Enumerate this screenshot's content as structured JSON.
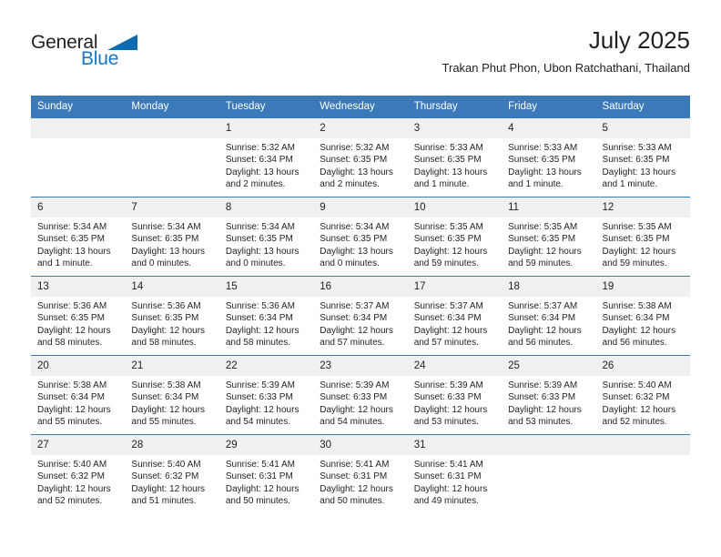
{
  "brand": {
    "name_part1": "General",
    "name_part2": "Blue"
  },
  "header": {
    "month_title": "July 2025",
    "location": "Trakan Phut Phon, Ubon Ratchathani, Thailand"
  },
  "colors": {
    "header_blue": "#3b79b8",
    "logo_blue": "#1b76bc",
    "daynum_bg": "#f0f0f0",
    "text": "#231f20"
  },
  "weekday_headers": [
    "Sunday",
    "Monday",
    "Tuesday",
    "Wednesday",
    "Thursday",
    "Friday",
    "Saturday"
  ],
  "weeks": [
    [
      {
        "day": "",
        "lines": []
      },
      {
        "day": "",
        "lines": []
      },
      {
        "day": "1",
        "lines": [
          "Sunrise: 5:32 AM",
          "Sunset: 6:34 PM",
          "Daylight: 13 hours",
          "and 2 minutes."
        ]
      },
      {
        "day": "2",
        "lines": [
          "Sunrise: 5:32 AM",
          "Sunset: 6:35 PM",
          "Daylight: 13 hours",
          "and 2 minutes."
        ]
      },
      {
        "day": "3",
        "lines": [
          "Sunrise: 5:33 AM",
          "Sunset: 6:35 PM",
          "Daylight: 13 hours",
          "and 1 minute."
        ]
      },
      {
        "day": "4",
        "lines": [
          "Sunrise: 5:33 AM",
          "Sunset: 6:35 PM",
          "Daylight: 13 hours",
          "and 1 minute."
        ]
      },
      {
        "day": "5",
        "lines": [
          "Sunrise: 5:33 AM",
          "Sunset: 6:35 PM",
          "Daylight: 13 hours",
          "and 1 minute."
        ]
      }
    ],
    [
      {
        "day": "6",
        "lines": [
          "Sunrise: 5:34 AM",
          "Sunset: 6:35 PM",
          "Daylight: 13 hours",
          "and 1 minute."
        ]
      },
      {
        "day": "7",
        "lines": [
          "Sunrise: 5:34 AM",
          "Sunset: 6:35 PM",
          "Daylight: 13 hours",
          "and 0 minutes."
        ]
      },
      {
        "day": "8",
        "lines": [
          "Sunrise: 5:34 AM",
          "Sunset: 6:35 PM",
          "Daylight: 13 hours",
          "and 0 minutes."
        ]
      },
      {
        "day": "9",
        "lines": [
          "Sunrise: 5:34 AM",
          "Sunset: 6:35 PM",
          "Daylight: 13 hours",
          "and 0 minutes."
        ]
      },
      {
        "day": "10",
        "lines": [
          "Sunrise: 5:35 AM",
          "Sunset: 6:35 PM",
          "Daylight: 12 hours",
          "and 59 minutes."
        ]
      },
      {
        "day": "11",
        "lines": [
          "Sunrise: 5:35 AM",
          "Sunset: 6:35 PM",
          "Daylight: 12 hours",
          "and 59 minutes."
        ]
      },
      {
        "day": "12",
        "lines": [
          "Sunrise: 5:35 AM",
          "Sunset: 6:35 PM",
          "Daylight: 12 hours",
          "and 59 minutes."
        ]
      }
    ],
    [
      {
        "day": "13",
        "lines": [
          "Sunrise: 5:36 AM",
          "Sunset: 6:35 PM",
          "Daylight: 12 hours",
          "and 58 minutes."
        ]
      },
      {
        "day": "14",
        "lines": [
          "Sunrise: 5:36 AM",
          "Sunset: 6:35 PM",
          "Daylight: 12 hours",
          "and 58 minutes."
        ]
      },
      {
        "day": "15",
        "lines": [
          "Sunrise: 5:36 AM",
          "Sunset: 6:34 PM",
          "Daylight: 12 hours",
          "and 58 minutes."
        ]
      },
      {
        "day": "16",
        "lines": [
          "Sunrise: 5:37 AM",
          "Sunset: 6:34 PM",
          "Daylight: 12 hours",
          "and 57 minutes."
        ]
      },
      {
        "day": "17",
        "lines": [
          "Sunrise: 5:37 AM",
          "Sunset: 6:34 PM",
          "Daylight: 12 hours",
          "and 57 minutes."
        ]
      },
      {
        "day": "18",
        "lines": [
          "Sunrise: 5:37 AM",
          "Sunset: 6:34 PM",
          "Daylight: 12 hours",
          "and 56 minutes."
        ]
      },
      {
        "day": "19",
        "lines": [
          "Sunrise: 5:38 AM",
          "Sunset: 6:34 PM",
          "Daylight: 12 hours",
          "and 56 minutes."
        ]
      }
    ],
    [
      {
        "day": "20",
        "lines": [
          "Sunrise: 5:38 AM",
          "Sunset: 6:34 PM",
          "Daylight: 12 hours",
          "and 55 minutes."
        ]
      },
      {
        "day": "21",
        "lines": [
          "Sunrise: 5:38 AM",
          "Sunset: 6:34 PM",
          "Daylight: 12 hours",
          "and 55 minutes."
        ]
      },
      {
        "day": "22",
        "lines": [
          "Sunrise: 5:39 AM",
          "Sunset: 6:33 PM",
          "Daylight: 12 hours",
          "and 54 minutes."
        ]
      },
      {
        "day": "23",
        "lines": [
          "Sunrise: 5:39 AM",
          "Sunset: 6:33 PM",
          "Daylight: 12 hours",
          "and 54 minutes."
        ]
      },
      {
        "day": "24",
        "lines": [
          "Sunrise: 5:39 AM",
          "Sunset: 6:33 PM",
          "Daylight: 12 hours",
          "and 53 minutes."
        ]
      },
      {
        "day": "25",
        "lines": [
          "Sunrise: 5:39 AM",
          "Sunset: 6:33 PM",
          "Daylight: 12 hours",
          "and 53 minutes."
        ]
      },
      {
        "day": "26",
        "lines": [
          "Sunrise: 5:40 AM",
          "Sunset: 6:32 PM",
          "Daylight: 12 hours",
          "and 52 minutes."
        ]
      }
    ],
    [
      {
        "day": "27",
        "lines": [
          "Sunrise: 5:40 AM",
          "Sunset: 6:32 PM",
          "Daylight: 12 hours",
          "and 52 minutes."
        ]
      },
      {
        "day": "28",
        "lines": [
          "Sunrise: 5:40 AM",
          "Sunset: 6:32 PM",
          "Daylight: 12 hours",
          "and 51 minutes."
        ]
      },
      {
        "day": "29",
        "lines": [
          "Sunrise: 5:41 AM",
          "Sunset: 6:31 PM",
          "Daylight: 12 hours",
          "and 50 minutes."
        ]
      },
      {
        "day": "30",
        "lines": [
          "Sunrise: 5:41 AM",
          "Sunset: 6:31 PM",
          "Daylight: 12 hours",
          "and 50 minutes."
        ]
      },
      {
        "day": "31",
        "lines": [
          "Sunrise: 5:41 AM",
          "Sunset: 6:31 PM",
          "Daylight: 12 hours",
          "and 49 minutes."
        ]
      },
      {
        "day": "",
        "lines": []
      },
      {
        "day": "",
        "lines": []
      }
    ]
  ]
}
